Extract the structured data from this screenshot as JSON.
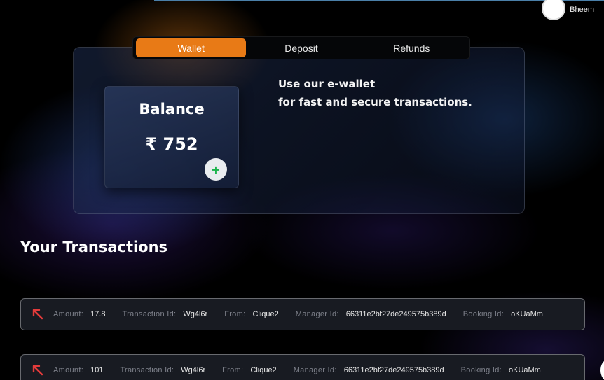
{
  "user": {
    "name": "Bheem"
  },
  "tabs": [
    {
      "label": "Wallet",
      "active": true
    },
    {
      "label": "Deposit",
      "active": false
    },
    {
      "label": "Refunds",
      "active": false
    }
  ],
  "balance": {
    "title": "Balance",
    "value": "₹ 752",
    "add_label": "+"
  },
  "promo": {
    "line1": "Use our e-wallet",
    "line2": "for fast and secure transactions."
  },
  "transactions_title": "Your Transactions",
  "labels": {
    "amount": "Amount:",
    "transaction_id": "Transaction Id:",
    "from": "From:",
    "manager_id": "Manager Id:",
    "booking_id": "Booking Id:"
  },
  "transactions": [
    {
      "amount": "17.8",
      "transaction_id": "Wg4l6r",
      "from": "Clique2",
      "manager_id": "66311e2bf27de249575b389d",
      "booking_id": "oKUaMm"
    },
    {
      "amount": "101",
      "transaction_id": "Wg4l6r",
      "from": "Clique2",
      "manager_id": "66311e2bf27de249575b389d",
      "booking_id": "oKUaMm"
    }
  ],
  "colors": {
    "accent": "#e87a16",
    "arrow": "#e23b3b",
    "add": "#19b44a"
  }
}
